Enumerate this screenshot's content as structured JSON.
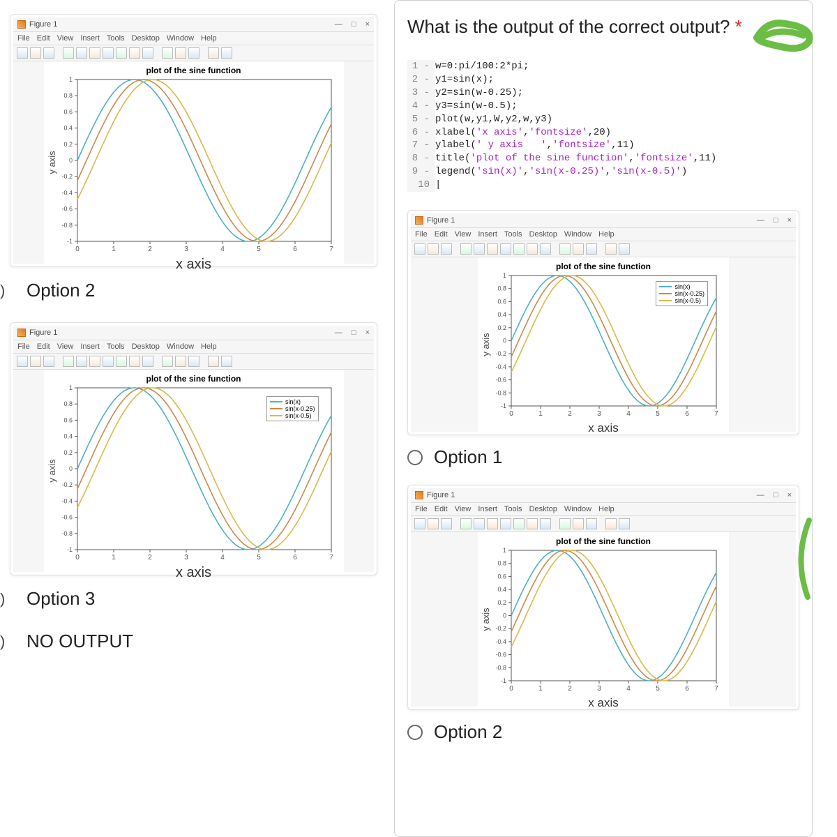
{
  "question": {
    "text": "What is the output of the correct output?",
    "required": "*"
  },
  "code": [
    {
      "n": "1 -",
      "t": "w=0:pi/100:2*pi;"
    },
    {
      "n": "2 -",
      "t": "y1=sin(x);"
    },
    {
      "n": "3 -",
      "t": "y2=sin(w-0.25);"
    },
    {
      "n": "4 -",
      "t": "y3=sin(w-0.5);"
    },
    {
      "n": "5 -",
      "t": "plot(w,y1,W,y2,w,y3)"
    },
    {
      "n": "6 -",
      "t_pre": "xlabel(",
      "t_str": "'x axis'",
      "t_mid": ",",
      "t_str2": "'fontsize'",
      "t_post": ",20)"
    },
    {
      "n": "7 -",
      "t_pre": "ylabel(",
      "t_str": "' y axis   '",
      "t_mid": ",",
      "t_str2": "'fontsize'",
      "t_post": ",11)"
    },
    {
      "n": "8 -",
      "t_pre": "title(",
      "t_str": "'plot of the sine function'",
      "t_mid": ",",
      "t_str2": "'fontsize'",
      "t_post": ",11)"
    },
    {
      "n": "9 -",
      "t_pre": "legend(",
      "t_str": "'sin(x)'",
      "t_mid": ",",
      "t_str2": "'sin(x-0.25)'",
      "t_mid2": ",",
      "t_str3": "'sin(x-0.5)'",
      "t_post": ")"
    },
    {
      "n": "10",
      "t": "|"
    }
  ],
  "figure": {
    "title": "Figure 1",
    "menu": [
      "File",
      "Edit",
      "View",
      "Insert",
      "Tools",
      "Desktop",
      "Window",
      "Help"
    ],
    "plot_title": "plot of the sine function",
    "xlabel": "x axis",
    "ylabel": "y axis",
    "legend": [
      "sin(x)",
      "sin(x-0.25)",
      "sin(x-0.5)"
    ],
    "win_min": "—",
    "win_sq": "□",
    "win_x": "×"
  },
  "options": {
    "opt1": "Option 1",
    "opt2": "Option 2",
    "opt3": "Option 3",
    "opt4": "NO OUTPUT",
    "opt2b": "Option 2"
  },
  "chart_data": {
    "type": "line",
    "title": "plot of the sine function",
    "xlabel": "x axis",
    "ylabel": "y axis",
    "xlim": [
      0,
      7
    ],
    "ylim": [
      -1,
      1
    ],
    "xticks": [
      0,
      1,
      2,
      3,
      4,
      5,
      6,
      7
    ],
    "yticks": [
      -1,
      -0.8,
      -0.6,
      -0.4,
      -0.2,
      0,
      0.2,
      0.4,
      0.6,
      0.8,
      1
    ],
    "series": [
      {
        "name": "sin(x)",
        "color": "#4db0c4",
        "phase": 0
      },
      {
        "name": "sin(x-0.25)",
        "color": "#c98a4b",
        "phase": 0.25
      },
      {
        "name": "sin(x-0.5)",
        "color": "#d8b94a",
        "phase": 0.5
      }
    ],
    "colors": {
      "s1": "#4db0c4",
      "s2": "#c98a4b",
      "s3": "#d8b94a"
    }
  }
}
